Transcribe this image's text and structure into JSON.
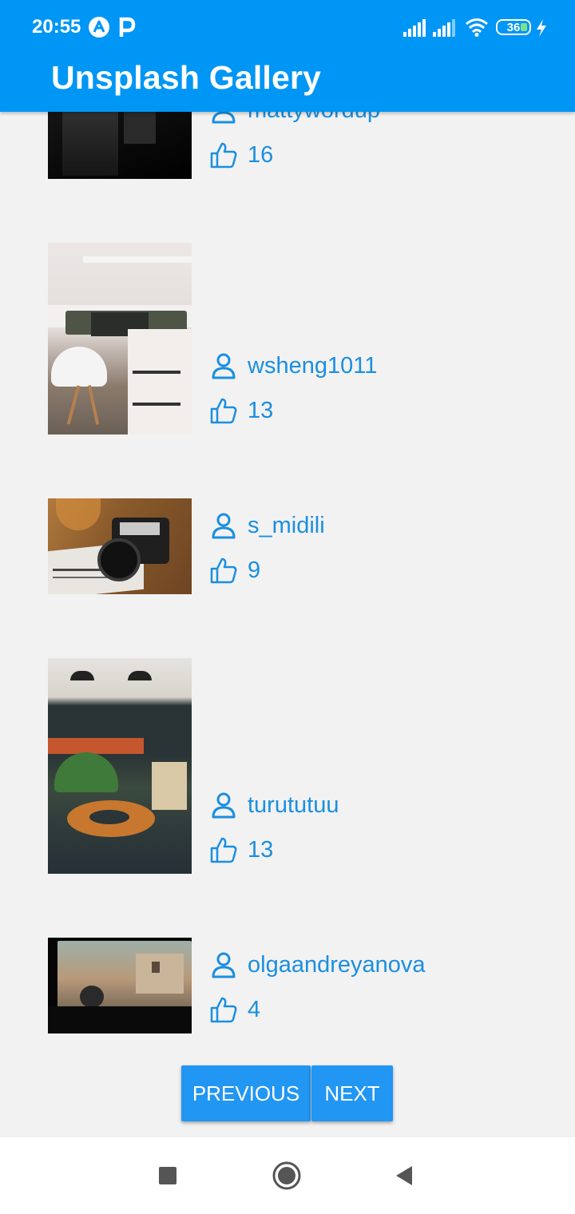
{
  "status_bar": {
    "time": "20:55",
    "battery": "36",
    "icons": [
      "a-app-icon",
      "p-app-icon",
      "signal-icon",
      "signal-icon",
      "wifi-icon",
      "battery-icon",
      "charging-icon"
    ]
  },
  "app": {
    "title": "Unsplash Gallery",
    "accent": "#0096f5",
    "meta_color": "#1a8fe0"
  },
  "photos": [
    {
      "username": "mattywordup",
      "likes": "16"
    },
    {
      "username": "wsheng1011",
      "likes": "13"
    },
    {
      "username": "s_midili",
      "likes": "9"
    },
    {
      "username": "turututuu",
      "likes": "13"
    },
    {
      "username": "olgaandreyanova",
      "likes": "4"
    }
  ],
  "pagination": {
    "previous_label": "PREVIOUS",
    "next_label": "NEXT"
  },
  "nav": {
    "icons": [
      "recents-square-icon",
      "home-circle-icon",
      "back-triangle-icon"
    ]
  }
}
